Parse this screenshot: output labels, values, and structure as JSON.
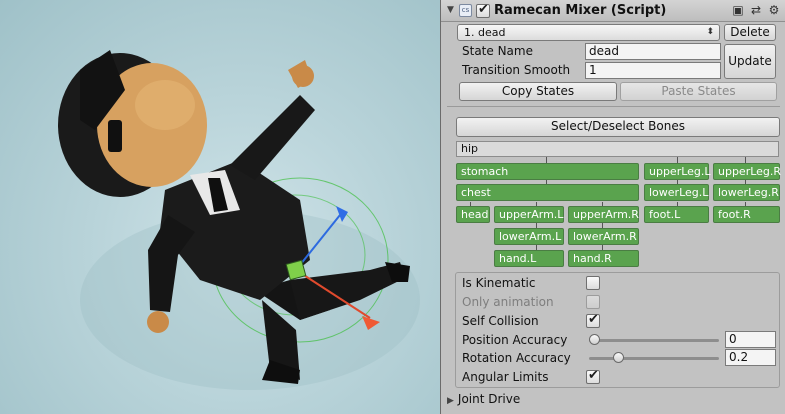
{
  "component": {
    "title": "Ramecan Mixer (Script)",
    "enabled": true,
    "icons": [
      "book-icon",
      "preset-icon",
      "gear-icon"
    ]
  },
  "state_dropdown": {
    "selected": "1. dead"
  },
  "buttons": {
    "delete": "Delete",
    "update": "Update",
    "copy_states": "Copy States",
    "paste_states": "Paste States",
    "select_bones": "Select/Deselect Bones"
  },
  "state": {
    "name_label": "State Name",
    "name_value": "dead",
    "smooth_label": "Transition Smooth",
    "smooth_value": "1"
  },
  "bones": {
    "root": "hip",
    "items": [
      "stomach",
      "upperLeg.L",
      "upperLeg.R",
      "chest",
      "lowerLeg.L",
      "lowerLeg.R",
      "head",
      "upperArm.L",
      "upperArm.R",
      "foot.L",
      "foot.R",
      "lowerArm.L",
      "lowerArm.R",
      "hand.L",
      "hand.R"
    ],
    "color": "#5aa34e"
  },
  "settings": {
    "is_kinematic": {
      "label": "Is Kinematic",
      "checked": false
    },
    "only_animation": {
      "label": "Only animation",
      "checked": false,
      "disabled": true
    },
    "self_collision": {
      "label": "Self Collision",
      "checked": true
    },
    "position_accuracy": {
      "label": "Position Accuracy",
      "value": "0",
      "fraction": 0.0
    },
    "rotation_accuracy": {
      "label": "Rotation Accuracy",
      "value": "0.2",
      "fraction": 0.2
    },
    "angular_limits": {
      "label": "Angular Limits",
      "checked": true
    }
  },
  "joint_drive": {
    "label": "Joint Drive"
  }
}
